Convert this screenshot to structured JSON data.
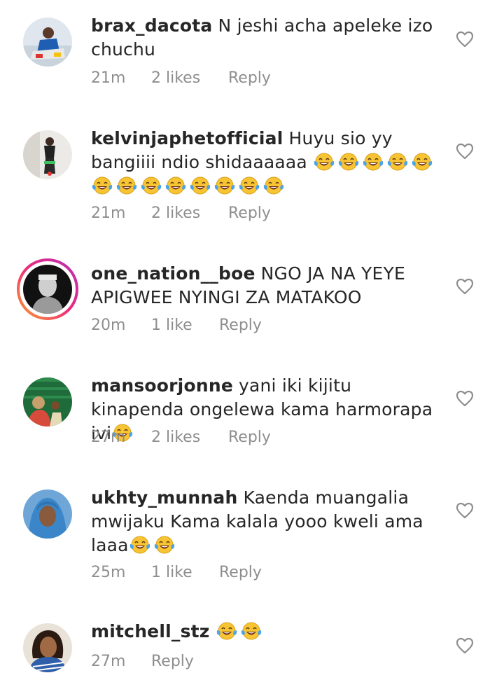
{
  "comments": [
    {
      "username": "brax_dacota",
      "text": "N jeshi acha apeleke izo chuchu",
      "emoji_count": 0,
      "time": "21m",
      "likes": "2 likes",
      "reply": "Reply"
    },
    {
      "username": "kelvinjaphetofficial",
      "text": "Huyu sio yy bangiiii ndio shidaaaaaa",
      "emoji_count": 13,
      "time": "21m",
      "likes": "2 likes",
      "reply": "Reply"
    },
    {
      "username": "one_nation__boe",
      "text": "NGO JA NA YEYE APIGWEE NYINGI ZA MATAKOO",
      "emoji_count": 0,
      "time": "20m",
      "likes": "1 like",
      "reply": "Reply"
    },
    {
      "username": "mansoorjonne",
      "text": "yani iki kijitu kinapenda ongelewa kama harmorapa ivi",
      "emoji_count": 1,
      "time": "27m",
      "likes": "2 likes",
      "reply": "Reply"
    },
    {
      "username": "ukhty_munnah",
      "text": "Kaenda muangalia mwijaku Kama kalala yooo kweli ama laaa",
      "emoji_count": 2,
      "time": "25m",
      "likes": "1 like",
      "reply": "Reply"
    },
    {
      "username": "mitchell_stz",
      "text": "",
      "emoji_count": 2,
      "time": "27m",
      "likes": "",
      "reply": "Reply"
    }
  ],
  "icons": {
    "heart": "heart-outline-icon",
    "emoji": "face-with-tears-of-joy-icon"
  },
  "colors": {
    "text": "#262626",
    "meta": "#8e8e8e",
    "emoji_face": "#f7c433",
    "emoji_tears": "#4aa3e8"
  }
}
